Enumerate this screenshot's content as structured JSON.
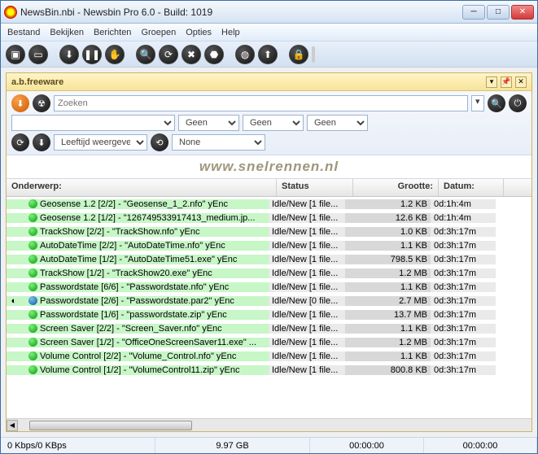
{
  "window": {
    "title": "NewsBin.nbi - Newsbin Pro 6.0 - Build: 1019"
  },
  "menu": [
    "Bestand",
    "Bekijken",
    "Berichten",
    "Groepen",
    "Opties",
    "Help"
  ],
  "toolbar_icons": [
    "⬛",
    "📁",
    "⬇",
    "⏸",
    "✋",
    "🔍",
    "🔄",
    "✖",
    "🛡",
    "🌐",
    "⬆",
    "🔒"
  ],
  "panel": {
    "title": "a.b.freeware"
  },
  "search": {
    "placeholder": "Zoeken",
    "filter_default": "Geen",
    "age_label": "Leeftijd weergeve",
    "none_label": "None"
  },
  "watermark": "www.snelrennen.nl",
  "columns": {
    "subject": "Onderwerp:",
    "status": "Status",
    "size": "Grootte:",
    "date": "Datum:"
  },
  "rows": [
    {
      "subject": "Geosense 1.2 [2/2] - \"Geosense_1_2.nfo\" yEnc",
      "status": "Idle/New [1 file...",
      "size": "1.2 KB",
      "date": "0d:1h:4m",
      "dot": "green"
    },
    {
      "subject": "Geosense 1.2 [1/2] - \"126749533917413_medium.jp...",
      "status": "Idle/New [1 file...",
      "size": "12.6 KB",
      "date": "0d:1h:4m",
      "dot": "green"
    },
    {
      "subject": "TrackShow [2/2] - \"TrackShow.nfo\" yEnc",
      "status": "Idle/New [1 file...",
      "size": "1.0 KB",
      "date": "0d:3h:17m",
      "dot": "green"
    },
    {
      "subject": "AutoDateTime [2/2] - \"AutoDateTime.nfo\" yEnc",
      "status": "Idle/New [1 file...",
      "size": "1.1 KB",
      "date": "0d:3h:17m",
      "dot": "green"
    },
    {
      "subject": "AutoDateTime [1/2] - \"AutoDateTime51.exe\" yEnc",
      "status": "Idle/New [1 file...",
      "size": "798.5 KB",
      "date": "0d:3h:17m",
      "dot": "green"
    },
    {
      "subject": "TrackShow [1/2] - \"TrackShow20.exe\" yEnc",
      "status": "Idle/New [1 file...",
      "size": "1.2 MB",
      "date": "0d:3h:17m",
      "dot": "green"
    },
    {
      "subject": "Passwordstate [6/6] - \"Passwordstate.nfo\" yEnc",
      "status": "Idle/New [1 file...",
      "size": "1.1 KB",
      "date": "0d:3h:17m",
      "dot": "green"
    },
    {
      "subject": "Passwordstate [2/6] - \"Passwordstate.par2\" yEnc",
      "status": "Idle/New [0 file...",
      "size": "2.7 MB",
      "date": "0d:3h:17m",
      "dot": "blue",
      "mark": "◐"
    },
    {
      "subject": "Passwordstate [1/6] - \"passwordstate.zip\" yEnc",
      "status": "Idle/New [1 file...",
      "size": "13.7 MB",
      "date": "0d:3h:17m",
      "dot": "green"
    },
    {
      "subject": "Screen Saver [2/2] - \"Screen_Saver.nfo\" yEnc",
      "status": "Idle/New [1 file...",
      "size": "1.1 KB",
      "date": "0d:3h:17m",
      "dot": "green"
    },
    {
      "subject": "Screen Saver [1/2] - \"OfficeOneScreenSaver11.exe\" ...",
      "status": "Idle/New [1 file...",
      "size": "1.2 MB",
      "date": "0d:3h:17m",
      "dot": "green"
    },
    {
      "subject": "Volume Control [2/2] - \"Volume_Control.nfo\" yEnc",
      "status": "Idle/New [1 file...",
      "size": "1.1 KB",
      "date": "0d:3h:17m",
      "dot": "green"
    },
    {
      "subject": "Volume Control [1/2] - \"VolumeControl11.zip\" yEnc",
      "status": "Idle/New [1 file...",
      "size": "800.8 KB",
      "date": "0d:3h:17m",
      "dot": "green"
    }
  ],
  "statusbar": {
    "speed": "0 Kbps/0 KBps",
    "size": "9.97 GB",
    "time1": "00:00:00",
    "time2": "00:00:00"
  }
}
